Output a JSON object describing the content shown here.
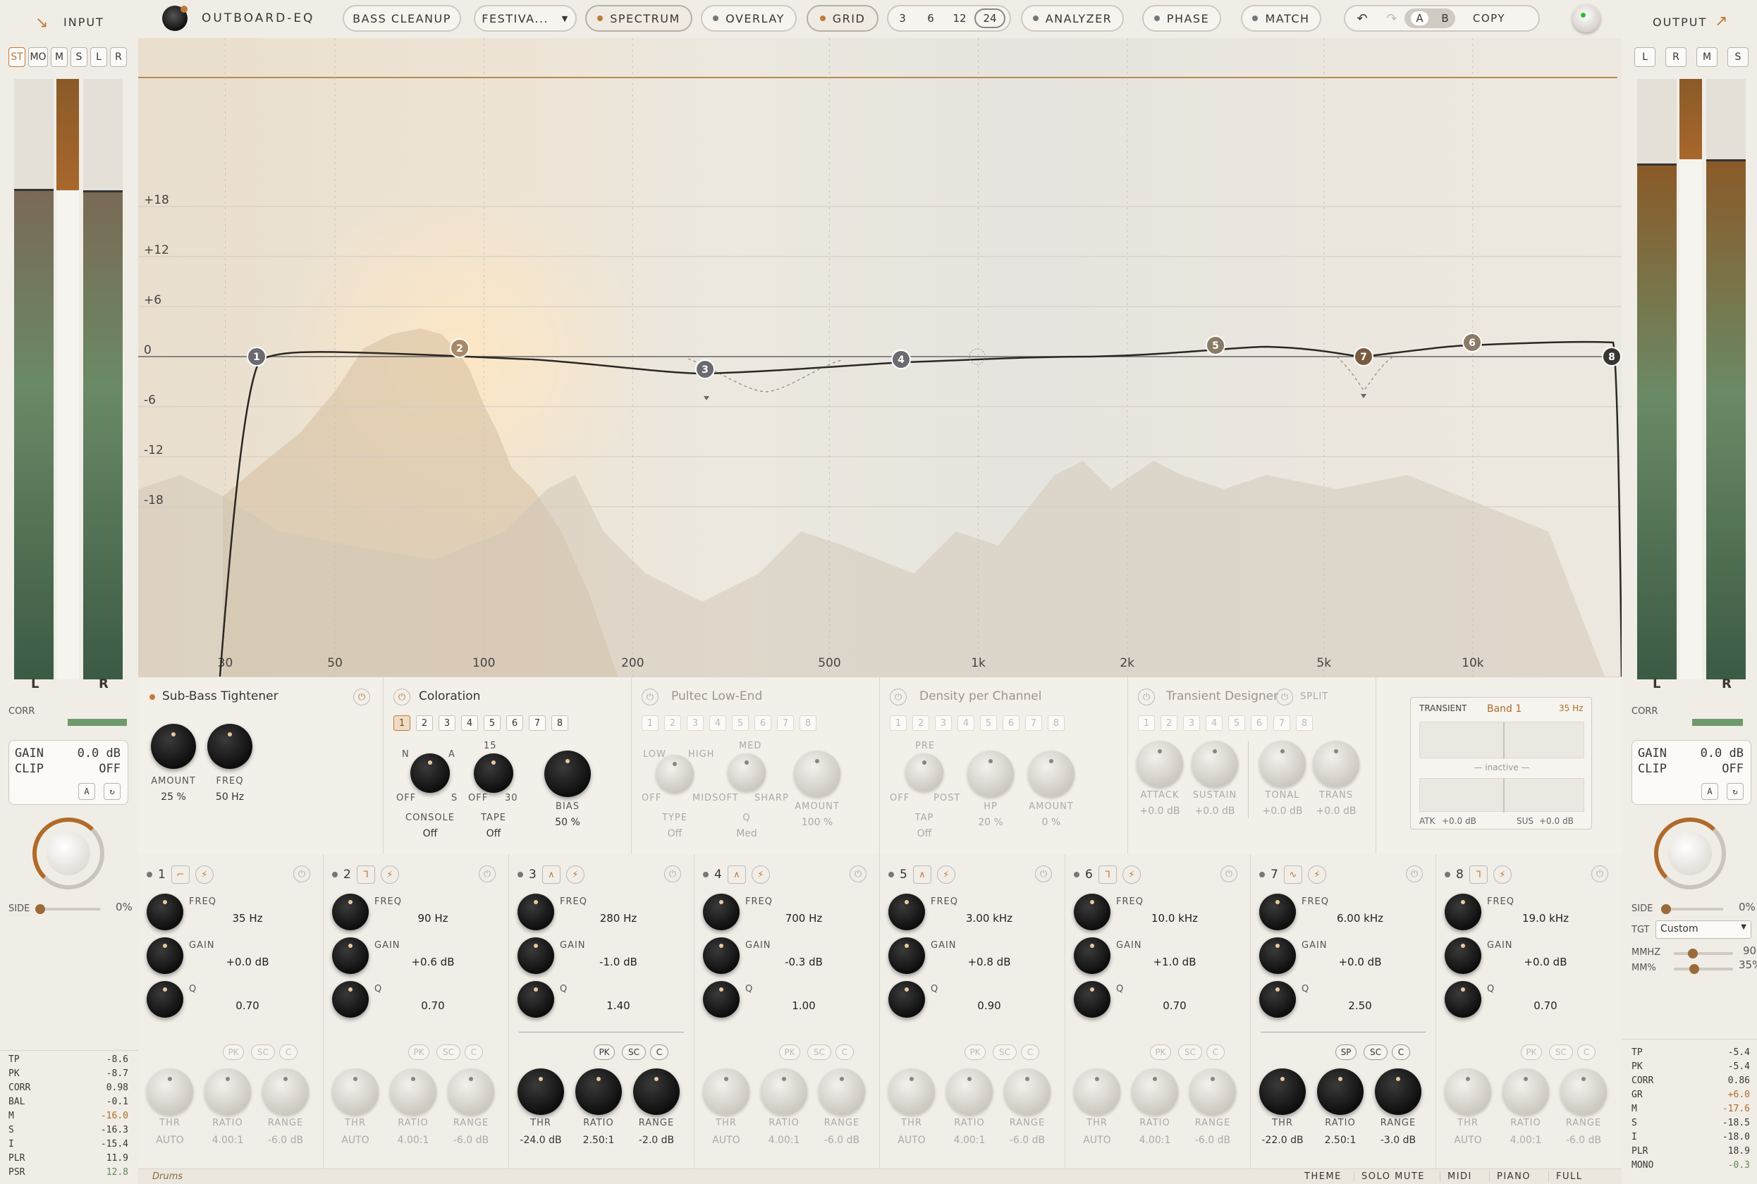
{
  "app": {
    "title": "OUTBOARD-EQ"
  },
  "topbar": {
    "preset": "BASS CLEANUP",
    "preset2": "FESTIVA...",
    "spectrum": "SPECTRUM",
    "overlay": "OVERLAY",
    "grid": "GRID",
    "grid_options": [
      "3",
      "6",
      "12",
      "24"
    ],
    "grid_selected": "24",
    "analyzer": "ANALYZER",
    "phase": "PHASE",
    "match": "MATCH",
    "a": "A",
    "b": "B",
    "copy": "COPY"
  },
  "input": {
    "label": "INPUT",
    "modes": [
      "ST",
      "MO",
      "M",
      "S",
      "L",
      "R"
    ],
    "mode_selected": "ST",
    "meter_l": "L",
    "meter_r": "R",
    "corr_label": "CORR",
    "gain_label": "GAIN",
    "gain_value": "0.0 dB",
    "clip_label": "CLIP",
    "clip_value": "OFF",
    "a": "A",
    "side_label": "SIDE",
    "side_value": "0%",
    "stats": [
      {
        "k": "TP",
        "v": "-8.6"
      },
      {
        "k": "PK",
        "v": "-8.7"
      },
      {
        "k": "CORR",
        "v": "0.98"
      },
      {
        "k": "BAL",
        "v": "-0.1"
      },
      {
        "k": "M",
        "v": "-16.0"
      },
      {
        "k": "S",
        "v": "-16.3"
      },
      {
        "k": "I",
        "v": "-15.4"
      },
      {
        "k": "PLR",
        "v": "11.9"
      },
      {
        "k": "PSR",
        "v": "12.8"
      }
    ]
  },
  "output": {
    "label": "OUTPUT",
    "modes": [
      "L",
      "R",
      "M",
      "S"
    ],
    "meter_l": "L",
    "meter_r": "R",
    "corr_label": "CORR",
    "gain_label": "GAIN",
    "gain_value": "0.0 dB",
    "clip_label": "CLIP",
    "clip_value": "OFF",
    "a": "A",
    "side_label": "SIDE",
    "side_value": "0%",
    "tgt_label": "TGT",
    "tgt_value": "Custom",
    "mmhz_label": "MMHZ",
    "mmhz_value": "90",
    "mmpct_label": "MM%",
    "mmpct_value": "35%",
    "stats": [
      {
        "k": "TP",
        "v": "-5.4"
      },
      {
        "k": "PK",
        "v": "-5.4"
      },
      {
        "k": "CORR",
        "v": "0.86"
      },
      {
        "k": "GR",
        "v": "+6.0"
      },
      {
        "k": "M",
        "v": "-17.6"
      },
      {
        "k": "S",
        "v": "-18.5"
      },
      {
        "k": "I",
        "v": "-18.0"
      },
      {
        "k": "PLR",
        "v": "18.9"
      },
      {
        "k": "MONO",
        "v": "-0.3"
      }
    ]
  },
  "graph": {
    "db_labels": [
      "+18",
      "+12",
      "+6",
      "0",
      "-6",
      "-12",
      "-18"
    ],
    "freq_labels": [
      "30",
      "50",
      "100",
      "200",
      "500",
      "1k",
      "2k",
      "5k",
      "10k"
    ],
    "nodes": [
      "1",
      "2",
      "3",
      "4",
      "5",
      "6",
      "7",
      "8"
    ]
  },
  "modules": {
    "subbass": {
      "title": "Sub-Bass Tightener",
      "amount_label": "AMOUNT",
      "amount_value": "25 %",
      "freq_label": "FREQ",
      "freq_value": "50 Hz"
    },
    "coloration": {
      "title": "Coloration",
      "nums": [
        "1",
        "2",
        "3",
        "4",
        "5",
        "6",
        "7",
        "8"
      ],
      "console_label": "CONSOLE",
      "console_value": "Off",
      "tape_label": "TAPE",
      "tape_value": "Off",
      "bias_label": "BIAS",
      "bias_value": "50 %",
      "n": "N",
      "a": "A",
      "off": "OFF",
      "s": "S",
      "t15": "15",
      "t30": "30",
      "off2": "OFF"
    },
    "pultec": {
      "title": "Pultec Low-End",
      "nums": [
        "1",
        "2",
        "3",
        "4",
        "5",
        "6",
        "7",
        "8"
      ],
      "low": "LOW",
      "high": "HIGH",
      "off": "OFF",
      "mid": "MID",
      "med": "MED",
      "soft": "SOFT",
      "sharp": "SHARP",
      "type_label": "TYPE",
      "type_value": "Off",
      "q_label": "Q",
      "q_value": "Med",
      "amount_label": "AMOUNT",
      "amount_value": "100 %"
    },
    "density": {
      "title": "Density per Channel",
      "nums": [
        "1",
        "2",
        "3",
        "4",
        "5",
        "6",
        "7",
        "8"
      ],
      "pre": "PRE",
      "off": "OFF",
      "post": "POST",
      "tap_label": "TAP",
      "tap_value": "Off",
      "hp_label": "HP",
      "hp_value": "20 %",
      "amount_label": "AMOUNT",
      "amount_value": "0 %"
    },
    "transient": {
      "title": "Transient Designer",
      "split": "SPLIT",
      "nums": [
        "1",
        "2",
        "3",
        "4",
        "5",
        "6",
        "7",
        "8"
      ],
      "knobs": [
        {
          "l": "ATTACK",
          "v": "+0.0 dB"
        },
        {
          "l": "SUSTAIN",
          "v": "+0.0 dB"
        },
        {
          "l": "TONAL",
          "v": "+0.0 dB"
        },
        {
          "l": "TRANS",
          "v": "+0.0 dB"
        }
      ]
    },
    "tpanel": {
      "title": "TRANSIENT",
      "band": "Band 1",
      "freq": "35 Hz",
      "inactive": "— inactive —",
      "atk_label": "ATK",
      "atk_value": "+0.0 dB",
      "sus_label": "SUS",
      "sus_value": "+0.0 dB"
    }
  },
  "bands": [
    {
      "n": "1",
      "freq": "35 Hz",
      "gain": "+0.0 dB",
      "q": "0.70",
      "thr": "AUTO",
      "ratio": "4.00:1",
      "range": "-6.0 dB",
      "active": false,
      "chips": [
        "PK",
        "SC",
        "C"
      ]
    },
    {
      "n": "2",
      "freq": "90 Hz",
      "gain": "+0.6 dB",
      "q": "0.70",
      "thr": "AUTO",
      "ratio": "4.00:1",
      "range": "-6.0 dB",
      "active": false,
      "chips": [
        "PK",
        "SC",
        "C"
      ]
    },
    {
      "n": "3",
      "freq": "280 Hz",
      "gain": "-1.0 dB",
      "q": "1.40",
      "thr": "-24.0 dB",
      "ratio": "2.50:1",
      "range": "-2.0 dB",
      "active": true,
      "chips": [
        "PK",
        "SC",
        "C"
      ]
    },
    {
      "n": "4",
      "freq": "700 Hz",
      "gain": "-0.3 dB",
      "q": "1.00",
      "thr": "AUTO",
      "ratio": "4.00:1",
      "range": "-6.0 dB",
      "active": false,
      "chips": [
        "PK",
        "SC",
        "C"
      ]
    },
    {
      "n": "5",
      "freq": "3.00 kHz",
      "gain": "+0.8 dB",
      "q": "0.90",
      "thr": "AUTO",
      "ratio": "4.00:1",
      "range": "-6.0 dB",
      "active": false,
      "chips": [
        "PK",
        "SC",
        "C"
      ]
    },
    {
      "n": "6",
      "freq": "10.0 kHz",
      "gain": "+1.0 dB",
      "q": "0.70",
      "thr": "AUTO",
      "ratio": "4.00:1",
      "range": "-6.0 dB",
      "active": false,
      "chips": [
        "PK",
        "SC",
        "C"
      ]
    },
    {
      "n": "7",
      "freq": "6.00 kHz",
      "gain": "+0.0 dB",
      "q": "2.50",
      "thr": "-22.0 dB",
      "ratio": "2.50:1",
      "range": "-3.0 dB",
      "active": true,
      "chips": [
        "SP",
        "SC",
        "C"
      ]
    },
    {
      "n": "8",
      "freq": "19.0 kHz",
      "gain": "+0.0 dB",
      "q": "0.70",
      "thr": "AUTO",
      "ratio": "4.00:1",
      "range": "-6.0 dB",
      "active": false,
      "chips": [
        "PK",
        "SC",
        "C"
      ]
    }
  ],
  "band_labels": {
    "freq": "FREQ",
    "gain": "GAIN",
    "q": "Q",
    "thr": "THR",
    "ratio": "RATIO",
    "range": "RANGE"
  },
  "footer": {
    "track": "Drums",
    "items": [
      "THEME",
      "SOLO MUTE",
      "MIDI",
      "PIANO",
      "FULL"
    ]
  }
}
